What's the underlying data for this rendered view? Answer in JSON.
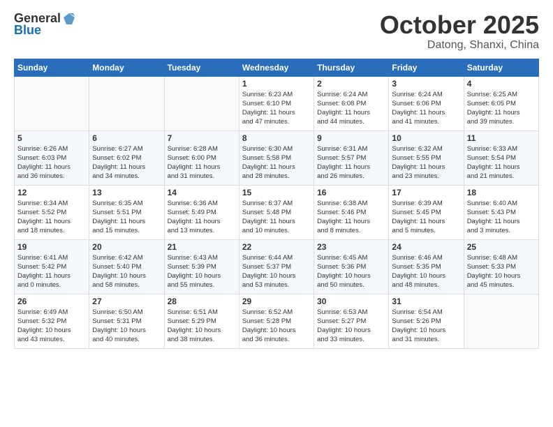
{
  "header": {
    "logo_line1": "General",
    "logo_line2": "Blue",
    "month": "October 2025",
    "location": "Datong, Shanxi, China"
  },
  "weekdays": [
    "Sunday",
    "Monday",
    "Tuesday",
    "Wednesday",
    "Thursday",
    "Friday",
    "Saturday"
  ],
  "weeks": [
    [
      {
        "day": "",
        "info": ""
      },
      {
        "day": "",
        "info": ""
      },
      {
        "day": "",
        "info": ""
      },
      {
        "day": "1",
        "info": "Sunrise: 6:23 AM\nSunset: 6:10 PM\nDaylight: 11 hours\nand 47 minutes."
      },
      {
        "day": "2",
        "info": "Sunrise: 6:24 AM\nSunset: 6:08 PM\nDaylight: 11 hours\nand 44 minutes."
      },
      {
        "day": "3",
        "info": "Sunrise: 6:24 AM\nSunset: 6:06 PM\nDaylight: 11 hours\nand 41 minutes."
      },
      {
        "day": "4",
        "info": "Sunrise: 6:25 AM\nSunset: 6:05 PM\nDaylight: 11 hours\nand 39 minutes."
      }
    ],
    [
      {
        "day": "5",
        "info": "Sunrise: 6:26 AM\nSunset: 6:03 PM\nDaylight: 11 hours\nand 36 minutes."
      },
      {
        "day": "6",
        "info": "Sunrise: 6:27 AM\nSunset: 6:02 PM\nDaylight: 11 hours\nand 34 minutes."
      },
      {
        "day": "7",
        "info": "Sunrise: 6:28 AM\nSunset: 6:00 PM\nDaylight: 11 hours\nand 31 minutes."
      },
      {
        "day": "8",
        "info": "Sunrise: 6:30 AM\nSunset: 5:58 PM\nDaylight: 11 hours\nand 28 minutes."
      },
      {
        "day": "9",
        "info": "Sunrise: 6:31 AM\nSunset: 5:57 PM\nDaylight: 11 hours\nand 26 minutes."
      },
      {
        "day": "10",
        "info": "Sunrise: 6:32 AM\nSunset: 5:55 PM\nDaylight: 11 hours\nand 23 minutes."
      },
      {
        "day": "11",
        "info": "Sunrise: 6:33 AM\nSunset: 5:54 PM\nDaylight: 11 hours\nand 21 minutes."
      }
    ],
    [
      {
        "day": "12",
        "info": "Sunrise: 6:34 AM\nSunset: 5:52 PM\nDaylight: 11 hours\nand 18 minutes."
      },
      {
        "day": "13",
        "info": "Sunrise: 6:35 AM\nSunset: 5:51 PM\nDaylight: 11 hours\nand 15 minutes."
      },
      {
        "day": "14",
        "info": "Sunrise: 6:36 AM\nSunset: 5:49 PM\nDaylight: 11 hours\nand 13 minutes."
      },
      {
        "day": "15",
        "info": "Sunrise: 6:37 AM\nSunset: 5:48 PM\nDaylight: 11 hours\nand 10 minutes."
      },
      {
        "day": "16",
        "info": "Sunrise: 6:38 AM\nSunset: 5:46 PM\nDaylight: 11 hours\nand 8 minutes."
      },
      {
        "day": "17",
        "info": "Sunrise: 6:39 AM\nSunset: 5:45 PM\nDaylight: 11 hours\nand 5 minutes."
      },
      {
        "day": "18",
        "info": "Sunrise: 6:40 AM\nSunset: 5:43 PM\nDaylight: 11 hours\nand 3 minutes."
      }
    ],
    [
      {
        "day": "19",
        "info": "Sunrise: 6:41 AM\nSunset: 5:42 PM\nDaylight: 11 hours\nand 0 minutes."
      },
      {
        "day": "20",
        "info": "Sunrise: 6:42 AM\nSunset: 5:40 PM\nDaylight: 10 hours\nand 58 minutes."
      },
      {
        "day": "21",
        "info": "Sunrise: 6:43 AM\nSunset: 5:39 PM\nDaylight: 10 hours\nand 55 minutes."
      },
      {
        "day": "22",
        "info": "Sunrise: 6:44 AM\nSunset: 5:37 PM\nDaylight: 10 hours\nand 53 minutes."
      },
      {
        "day": "23",
        "info": "Sunrise: 6:45 AM\nSunset: 5:36 PM\nDaylight: 10 hours\nand 50 minutes."
      },
      {
        "day": "24",
        "info": "Sunrise: 6:46 AM\nSunset: 5:35 PM\nDaylight: 10 hours\nand 48 minutes."
      },
      {
        "day": "25",
        "info": "Sunrise: 6:48 AM\nSunset: 5:33 PM\nDaylight: 10 hours\nand 45 minutes."
      }
    ],
    [
      {
        "day": "26",
        "info": "Sunrise: 6:49 AM\nSunset: 5:32 PM\nDaylight: 10 hours\nand 43 minutes."
      },
      {
        "day": "27",
        "info": "Sunrise: 6:50 AM\nSunset: 5:31 PM\nDaylight: 10 hours\nand 40 minutes."
      },
      {
        "day": "28",
        "info": "Sunrise: 6:51 AM\nSunset: 5:29 PM\nDaylight: 10 hours\nand 38 minutes."
      },
      {
        "day": "29",
        "info": "Sunrise: 6:52 AM\nSunset: 5:28 PM\nDaylight: 10 hours\nand 36 minutes."
      },
      {
        "day": "30",
        "info": "Sunrise: 6:53 AM\nSunset: 5:27 PM\nDaylight: 10 hours\nand 33 minutes."
      },
      {
        "day": "31",
        "info": "Sunrise: 6:54 AM\nSunset: 5:26 PM\nDaylight: 10 hours\nand 31 minutes."
      },
      {
        "day": "",
        "info": ""
      }
    ]
  ]
}
